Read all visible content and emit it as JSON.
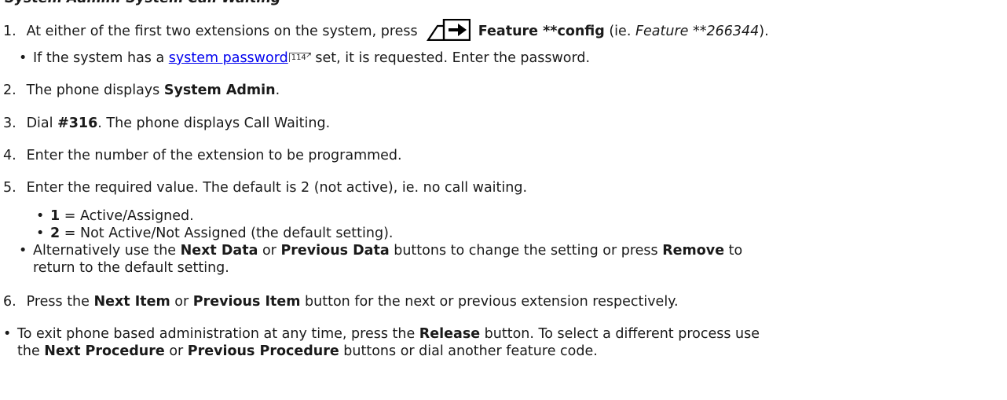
{
  "cut_heading": "System Admin: System Call Waiting",
  "steps": {
    "s1": {
      "number": "1.",
      "pre": "At either of the first two extensions on the system, press",
      "icon": "feature-button-icon",
      "bold": "Feature **config",
      "mid": " (ie. ",
      "italic": "Feature **266344",
      "post": ")."
    },
    "s1_bullet": {
      "pre": "If the system has a ",
      "link": "system password",
      "ref": "114",
      "post": " set, it is requested. Enter the password."
    },
    "s2": {
      "number": "2.",
      "pre": "The phone displays ",
      "bold": "System Admin",
      "post": "."
    },
    "s3": {
      "number": "3.",
      "pre": "Dial ",
      "bold": "#316",
      "post": ". The phone displays Call Waiting."
    },
    "s4": {
      "number": "4.",
      "text": "Enter the number of the extension to be programmed."
    },
    "s5": {
      "number": "5.",
      "text": "Enter the required value. The default is 2 (not active), ie. no call waiting."
    },
    "s5_opt1": {
      "bold": "1",
      "text": " = Active/Assigned."
    },
    "s5_opt2": {
      "bold": "2",
      "text": " = Not Active/Not Assigned (the default setting)."
    },
    "s5_alt": {
      "pre": "Alternatively use the ",
      "b1": "Next Data",
      "mid1": " or ",
      "b2": "Previous Data",
      "mid2": " buttons to change the setting or press ",
      "b3": "Remove",
      "post": " to",
      "line2": "return to the default setting."
    },
    "s6": {
      "number": "6.",
      "pre": "Press the ",
      "b1": "Next Item",
      "mid": " or ",
      "b2": "Previous Item",
      "post": " button for the next or previous extension respectively."
    }
  },
  "exit_note": {
    "pre": "To exit phone based administration at any time, press the ",
    "b1": "Release",
    "mid": " button. To select a different process use",
    "line2_pre": "the ",
    "b2": "Next Procedure",
    "line2_mid": " or ",
    "b3": "Previous Procedure",
    "line2_post": " buttons or dial another feature code."
  }
}
